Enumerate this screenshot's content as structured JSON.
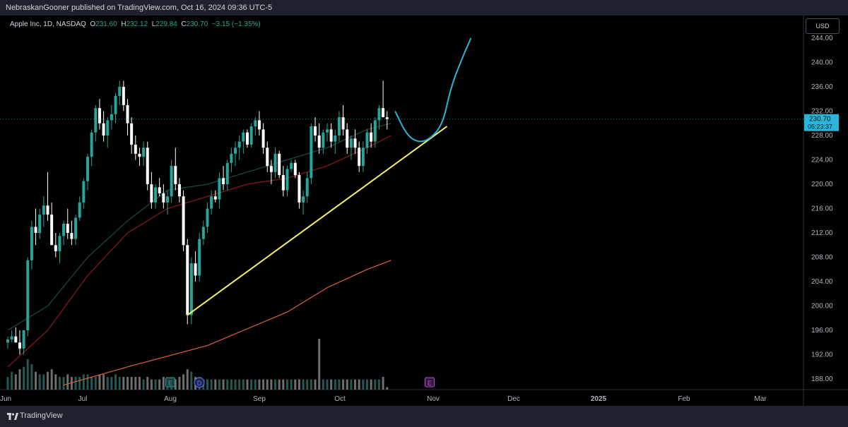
{
  "publish_bar": {
    "text": "NebraskanGooner published on TradingView.com, Oct 16, 2024 09:36 UTC-5"
  },
  "legend": {
    "symbol": "Apple Inc, 1D, NASDAQ",
    "o_label": "O",
    "o_value": "231.60",
    "h_label": "H",
    "h_value": "232.12",
    "l_label": "L",
    "l_value": "229.84",
    "c_label": "C",
    "c_value": "230.70",
    "change": "−3.15 (−1.35%)"
  },
  "currency_button": "USD",
  "price_tag": {
    "price": "230.70",
    "countdown": "05:23:37"
  },
  "branding": {
    "name": "TradingView"
  },
  "colors": {
    "up": "#26a69a",
    "down": "#ffffff",
    "ma_fast": "#1b4d3e",
    "ma_mid": "#8b1a1a",
    "ma_slow": "#e0603a",
    "trendline": "#f5f06a",
    "projection": "#29b6d8"
  },
  "chart_data": {
    "type": "candlestick",
    "ylim": [
      186,
      246
    ],
    "y_ticks": [
      "244.00",
      "240.00",
      "236.00",
      "232.00",
      "228.00",
      "224.00",
      "220.00",
      "216.00",
      "212.00",
      "208.00",
      "204.00",
      "200.00",
      "196.00",
      "192.00",
      "188.00"
    ],
    "x_ticks": [
      "Jun",
      "Jul",
      "Aug",
      "Sep",
      "Oct",
      "Nov",
      "Dec",
      "2025",
      "Feb",
      "Mar"
    ],
    "events": [
      {
        "label": "E",
        "date": "Aug"
      },
      {
        "label": "D",
        "date": "Aug"
      },
      {
        "label": "E",
        "date": "Nov"
      }
    ],
    "candles": [
      [
        194,
        195,
        193,
        194.5
      ],
      [
        194.5,
        196,
        194,
        195
      ],
      [
        195,
        196.5,
        194,
        194
      ],
      [
        194,
        196,
        192,
        193
      ],
      [
        193,
        196,
        192,
        196
      ],
      [
        196,
        208,
        195,
        207.5
      ],
      [
        207.5,
        214,
        206,
        213
      ],
      [
        213,
        216,
        210,
        212
      ],
      [
        212,
        216,
        211,
        215
      ],
      [
        215,
        218,
        213,
        216.5
      ],
      [
        216.5,
        222,
        214,
        215
      ],
      [
        215,
        217,
        210,
        210
      ],
      [
        210,
        212,
        208,
        209
      ],
      [
        209,
        212,
        207,
        211.5
      ],
      [
        211.5,
        214,
        210,
        213.5
      ],
      [
        213.5,
        216,
        211,
        212
      ],
      [
        212,
        214,
        210,
        211
      ],
      [
        211,
        215,
        210,
        214.5
      ],
      [
        214.5,
        218,
        214,
        217
      ],
      [
        217,
        221,
        216,
        220.5
      ],
      [
        220.5,
        225,
        219,
        224.5
      ],
      [
        224.5,
        229,
        223,
        228.5
      ],
      [
        228.5,
        233,
        227,
        232.5
      ],
      [
        232.5,
        234,
        229,
        230
      ],
      [
        230,
        232,
        227,
        228
      ],
      [
        228,
        231,
        226,
        230.5
      ],
      [
        230.5,
        233,
        229,
        231.5
      ],
      [
        231.5,
        235,
        230,
        234.5
      ],
      [
        234.5,
        237,
        233,
        236
      ],
      [
        236,
        237,
        232,
        233
      ],
      [
        233,
        234,
        228,
        230
      ],
      [
        230,
        231,
        225,
        226.5
      ],
      [
        226.5,
        228,
        224,
        225
      ],
      [
        225,
        226,
        223,
        224.5
      ],
      [
        224.5,
        227,
        223,
        226
      ],
      [
        226,
        227,
        219,
        220
      ],
      [
        220,
        222,
        216,
        217
      ],
      [
        217,
        220,
        216,
        219.5
      ],
      [
        219.5,
        221,
        218,
        218.5
      ],
      [
        218.5,
        220,
        216,
        217
      ],
      [
        217,
        219,
        215,
        218
      ],
      [
        218,
        224,
        217,
        223
      ],
      [
        223,
        226,
        219,
        220
      ],
      [
        220,
        221,
        217,
        218
      ],
      [
        218,
        219,
        209,
        210
      ],
      [
        210,
        211,
        197,
        198.5
      ],
      [
        198.5,
        208,
        197,
        207
      ],
      [
        207,
        209,
        204,
        205
      ],
      [
        205,
        212,
        204,
        211
      ],
      [
        211,
        214,
        210,
        213
      ],
      [
        213,
        217,
        212,
        216
      ],
      [
        216,
        219,
        215,
        218
      ],
      [
        218,
        219,
        217,
        217.5
      ],
      [
        217.5,
        222,
        216,
        221
      ],
      [
        221,
        223,
        219,
        220
      ],
      [
        220,
        224,
        219,
        223.5
      ],
      [
        223.5,
        226,
        222,
        225
      ],
      [
        225,
        227,
        223,
        226
      ],
      [
        226,
        228,
        224,
        227
      ],
      [
        227,
        229,
        225,
        228.5
      ],
      [
        228.5,
        229,
        226,
        226.5
      ],
      [
        226.5,
        230,
        226,
        229.5
      ],
      [
        229.5,
        231,
        228,
        230.5
      ],
      [
        230.5,
        232,
        228,
        229
      ],
      [
        229,
        230,
        225,
        226
      ],
      [
        226,
        227,
        222,
        223
      ],
      [
        223,
        224,
        220,
        222
      ],
      [
        222,
        226,
        221,
        225
      ],
      [
        225,
        225.5,
        221,
        221.5
      ],
      [
        221.5,
        223,
        218,
        219
      ],
      [
        219,
        223,
        218,
        222.5
      ],
      [
        222.5,
        224,
        222,
        223.5
      ],
      [
        223.5,
        224,
        221,
        221.5
      ],
      [
        221.5,
        222,
        216,
        217
      ],
      [
        217,
        219,
        215,
        218
      ],
      [
        218,
        222,
        217,
        221
      ],
      [
        221,
        230,
        220,
        229.5
      ],
      [
        229.5,
        231,
        227,
        228
      ],
      [
        228,
        230,
        225,
        226
      ],
      [
        226,
        229,
        225,
        228.5
      ],
      [
        228.5,
        230,
        227,
        229
      ],
      [
        229,
        230,
        226,
        227
      ],
      [
        227,
        229,
        225,
        228
      ],
      [
        228,
        232,
        227,
        231
      ],
      [
        231,
        233,
        228,
        229
      ],
      [
        229,
        230,
        225,
        226
      ],
      [
        226,
        228,
        224,
        227.5
      ],
      [
        227.5,
        229,
        225,
        226
      ],
      [
        226,
        227,
        222,
        223
      ],
      [
        223,
        227,
        222,
        226
      ],
      [
        226,
        229,
        225,
        228.5
      ],
      [
        228.5,
        230,
        226,
        227
      ],
      [
        227,
        231,
        226,
        230.5
      ],
      [
        230.5,
        233,
        229,
        232.5
      ],
      [
        232.5,
        237,
        231,
        231
      ],
      [
        231,
        232,
        229,
        230.7
      ]
    ],
    "ma_fast": [
      [
        0,
        196
      ],
      [
        10,
        200
      ],
      [
        20,
        208
      ],
      [
        30,
        214
      ],
      [
        40,
        219
      ],
      [
        50,
        220
      ],
      [
        60,
        222
      ],
      [
        70,
        224
      ],
      [
        80,
        226
      ],
      [
        90,
        229
      ],
      [
        96,
        230
      ]
    ],
    "ma_mid": [
      [
        0,
        190
      ],
      [
        10,
        196
      ],
      [
        20,
        205
      ],
      [
        30,
        212
      ],
      [
        40,
        216
      ],
      [
        50,
        218
      ],
      [
        60,
        220
      ],
      [
        70,
        221
      ],
      [
        80,
        223
      ],
      [
        90,
        226
      ],
      [
        96,
        228
      ]
    ],
    "ma_slow": [
      [
        14,
        187
      ],
      [
        30,
        190
      ],
      [
        50,
        193.5
      ],
      [
        70,
        199
      ],
      [
        80,
        203
      ],
      [
        90,
        206
      ],
      [
        96,
        207.5
      ]
    ],
    "volume": [
      5,
      7,
      6,
      8,
      9,
      12,
      10,
      7,
      6,
      6,
      7,
      8,
      6,
      5,
      5,
      6,
      5,
      5,
      5,
      6,
      6,
      5,
      5,
      6,
      6,
      5,
      5,
      6,
      5,
      5,
      5,
      5,
      5,
      5,
      4,
      5,
      4,
      4,
      4,
      5,
      4,
      4,
      4,
      5,
      6,
      8,
      7,
      5,
      5,
      4,
      4,
      4,
      4,
      4,
      4,
      4,
      4,
      4,
      4,
      4,
      4,
      4,
      4,
      4,
      4,
      4,
      4,
      4,
      4,
      4,
      4,
      4,
      4,
      4,
      4,
      4,
      4,
      4,
      20,
      4,
      4,
      4,
      4,
      4,
      4,
      4,
      4,
      4,
      4,
      4,
      4,
      4,
      4,
      4,
      5,
      1
    ],
    "trendline": [
      [
        45,
        198.5
      ],
      [
        110,
        229.5
      ]
    ],
    "projection": [
      [
        97,
        232
      ],
      [
        100,
        228
      ],
      [
        103,
        226.8
      ],
      [
        106,
        227.5
      ],
      [
        109,
        230
      ],
      [
        111,
        236
      ],
      [
        114,
        241
      ],
      [
        116,
        244
      ]
    ]
  }
}
